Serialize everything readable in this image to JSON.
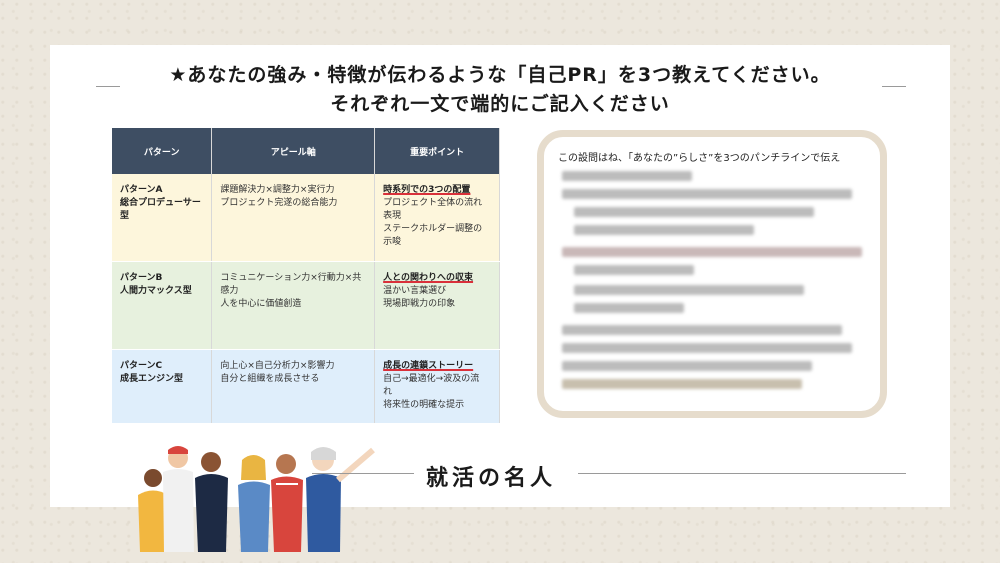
{
  "heading": {
    "line1": "★あなたの強み・特徴が伝わるような「自己PR」を3つ教えてください。",
    "line2": "それぞれ一文で端的にご記入ください"
  },
  "table": {
    "headers": [
      "パターン",
      "アピール軸",
      "重要ポイント"
    ],
    "rows": [
      {
        "pattern": [
          "パターンA",
          "総合プロデューサー型"
        ],
        "axis": [
          "課題解決力×調整力×実行力",
          "プロジェクト完遂の総合能力"
        ],
        "point_key": "時系列での3つの配置",
        "point_rest": [
          "プロジェクト全体の流れ",
          "表現",
          "ステークホルダー調整の",
          "示唆"
        ]
      },
      {
        "pattern": [
          "パターンB",
          "人間力マックス型"
        ],
        "axis": [
          "コミュニケーション力×行動力×共",
          "感力",
          "人を中心に価値創造"
        ],
        "point_key": "人との関わりへの収束",
        "point_rest": [
          "温かい言葉選び",
          "現場即戦力の印象"
        ]
      },
      {
        "pattern": [
          "パターンC",
          "成長エンジン型"
        ],
        "axis": [
          "向上心×自己分析力×影響力",
          "自分と組織を成長させる"
        ],
        "point_key": "成長の連鎖ストーリー",
        "point_rest": [
          "自己→最適化→波及の流",
          "れ",
          "将来性の明確な提示"
        ]
      }
    ]
  },
  "blur_panel": {
    "lead": "この設問はね、「あなたの”らしさ”を3つのパンチラインで伝え"
  },
  "brand": "就活の名人"
}
